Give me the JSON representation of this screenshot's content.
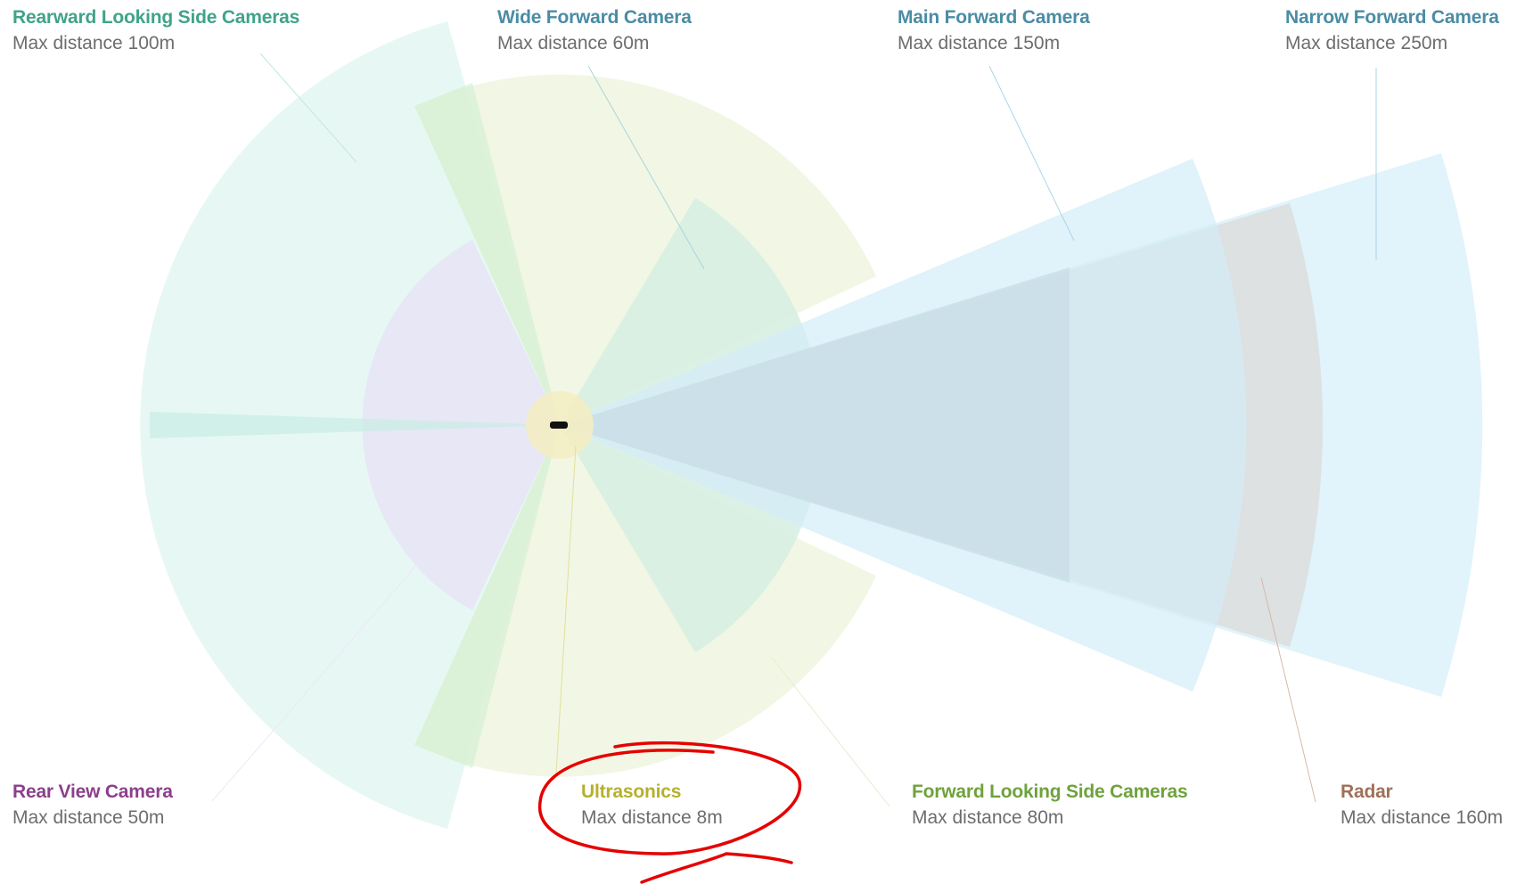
{
  "sensors": {
    "rearward_side": {
      "name": "Rearward Looking Side Cameras",
      "distance": "Max distance 100m",
      "color": "#3fa38a"
    },
    "wide_forward": {
      "name": "Wide Forward Camera",
      "distance": "Max distance 60m",
      "color": "#4a8ca4"
    },
    "main_forward": {
      "name": "Main Forward Camera",
      "distance": "Max distance 150m",
      "color": "#4a8ca4"
    },
    "narrow_forward": {
      "name": "Narrow Forward Camera",
      "distance": "Max distance 250m",
      "color": "#4a8ca4"
    },
    "rear_view": {
      "name": "Rear View Camera",
      "distance": "Max distance 50m",
      "color": "#8c3f8c"
    },
    "ultrasonics": {
      "name": "Ultrasonics",
      "distance": "Max distance 8m",
      "color": "#b5b02e"
    },
    "forward_side": {
      "name": "Forward Looking Side Cameras",
      "distance": "Max distance 80m",
      "color": "#6fa23c"
    },
    "radar": {
      "name": "Radar",
      "distance": "Max distance 160m",
      "color": "#a0705a"
    }
  },
  "annotation": {
    "type": "hand-drawn circle",
    "color": "#e60000",
    "target": "ultrasonics"
  }
}
